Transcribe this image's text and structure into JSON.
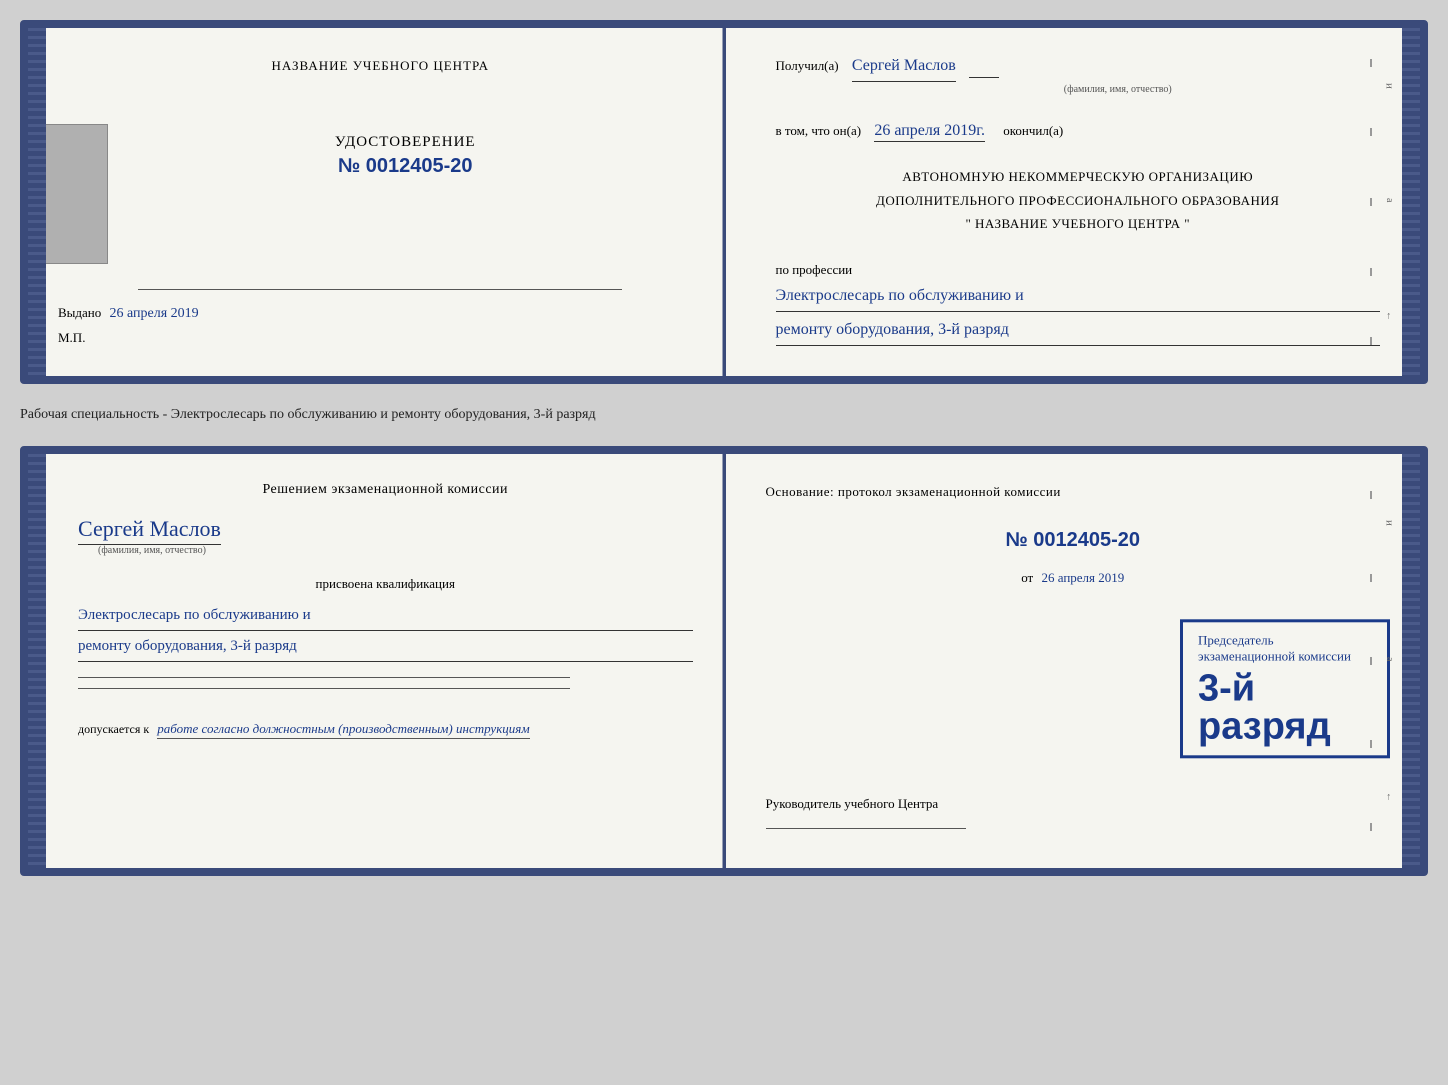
{
  "card1": {
    "left": {
      "center_title": "НАЗВАНИЕ УЧЕБНОГО ЦЕНТРА",
      "udostoverenie_label": "УДОСТОВЕРЕНИЕ",
      "number_prefix": "№",
      "number_value": "0012405-20",
      "vydano_label": "Выдано",
      "vydano_date": "26 апреля 2019",
      "mp_label": "М.П."
    },
    "right": {
      "poluchil_label": "Получил(а)",
      "poluchil_name": "Сергей Маслов",
      "fio_sublabel": "(фамилия, имя, отчество)",
      "vtom_label": "в том, что он(а)",
      "vtom_date": "26 апреля 2019г.",
      "okochil_label": "окончил(а)",
      "org_line1": "АВТОНОМНУЮ НЕКОММЕРЧЕСКУЮ ОРГАНИЗАЦИЮ",
      "org_line2": "ДОПОЛНИТЕЛЬНОГО ПРОФЕССИОНАЛЬНОГО ОБРАЗОВАНИЯ",
      "org_name": "\" НАЗВАНИЕ УЧЕБНОГО ЦЕНТРА \"",
      "po_professii_label": "по профессии",
      "profession_line1": "Электрослесарь по обслуживанию и",
      "profession_line2": "ремонту оборудования, 3-й разряд"
    }
  },
  "between_label": "Рабочая специальность - Электрослесарь по обслуживанию и ремонту оборудования, 3-й разряд",
  "card2": {
    "left": {
      "resheniyem_line1": "Решением экзаменационной комиссии",
      "name_handwritten": "Сергей Маслов",
      "fio_sublabel": "(фамилия, имя, отчество)",
      "prisvoena_label": "присвоена квалификация",
      "profession_line1": "Электрослесарь по обслуживанию и",
      "profession_line2": "ремонту оборудования, 3-й разряд",
      "dopuskaetsya_label": "допускается к",
      "dopuskaetsya_value": "работе согласно должностным (производственным) инструкциям"
    },
    "right": {
      "osnovanie_label": "Основание: протокол экзаменационной комиссии",
      "number_prefix": "№",
      "number_value": "0012405-20",
      "ot_label": "от",
      "ot_date": "26 апреля 2019",
      "predsedatel_label": "Председатель экзаменационной комиссии",
      "rukovoditel_label": "Руководитель учебного Центра"
    },
    "stamp": {
      "line1": "3-й разряд"
    }
  }
}
